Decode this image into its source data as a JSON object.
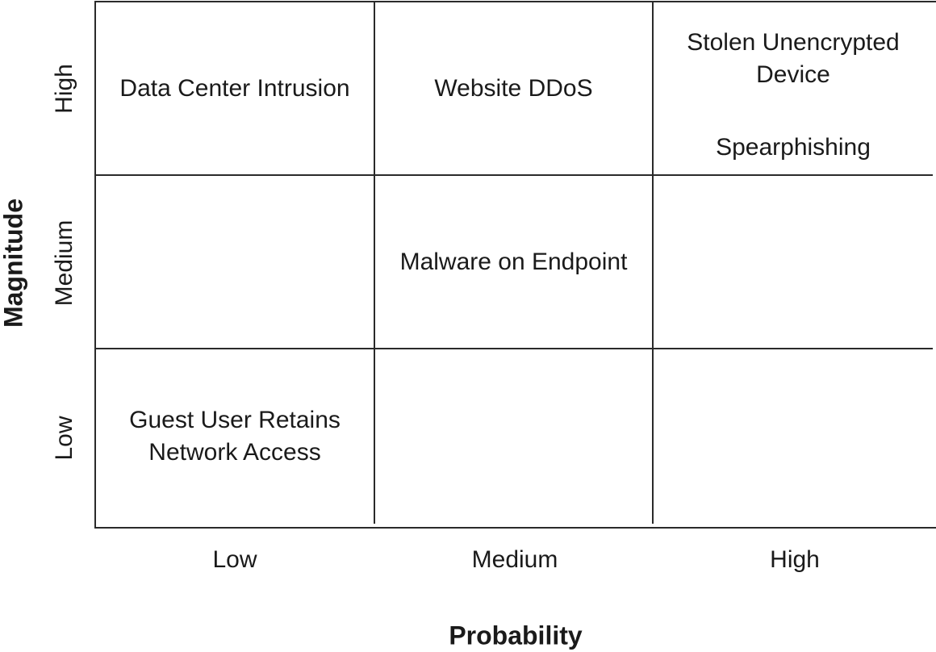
{
  "axes": {
    "y_title": "Magnitude",
    "x_title": "Probability",
    "y_ticks": {
      "high": "High",
      "medium": "Medium",
      "low": "Low"
    },
    "x_ticks": {
      "low": "Low",
      "medium": "Medium",
      "high": "High"
    }
  },
  "matrix": {
    "high_low": [
      "Data Center Intrusion"
    ],
    "high_medium": [
      "Website DDoS"
    ],
    "high_high": [
      "Stolen Unencrypted Device",
      "Spearphishing"
    ],
    "medium_low": [],
    "medium_medium": [
      "Malware on Endpoint"
    ],
    "medium_high": [],
    "low_low": [
      "Guest User Retains Network Access"
    ],
    "low_medium": [],
    "low_high": []
  },
  "colors": {
    "grid_line": "#2a2a2a",
    "text": "#1a1a1a",
    "background": "#ffffff"
  }
}
